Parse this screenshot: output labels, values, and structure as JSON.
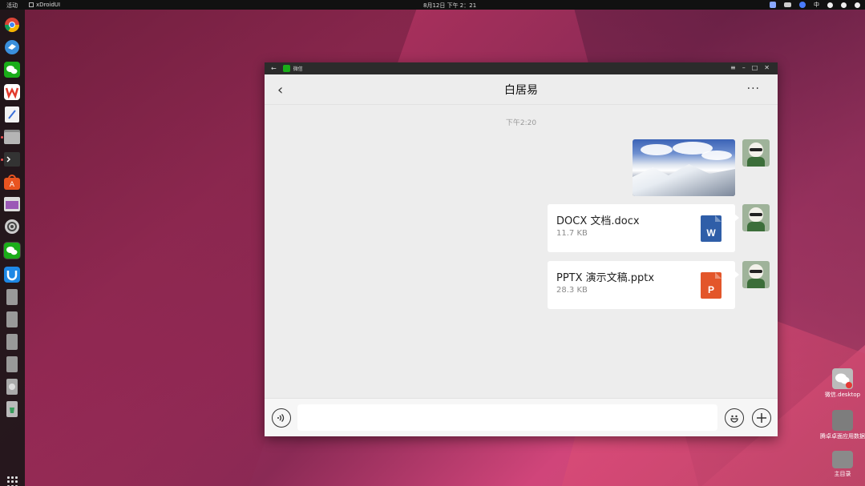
{
  "topbar": {
    "activities": "活动",
    "app_name": "xDroidUI",
    "clock": "8月12日 下午 2：21",
    "ime": "中"
  },
  "desktop": {
    "icons": [
      {
        "label": "微信.desktop"
      },
      {
        "label": "腾卓卓面应用数据"
      },
      {
        "label": "主目录"
      }
    ]
  },
  "window": {
    "app_title": "微信",
    "chat": {
      "title": "白居易",
      "timestamp": "下午2:20",
      "messages": [
        {
          "type": "image"
        },
        {
          "type": "file",
          "name": "DOCX 文档.docx",
          "size": "11.7 KB",
          "icon_letter": "W",
          "icon_color": "#2f5ea8"
        },
        {
          "type": "file",
          "name": "PPTX 演示文稿.pptx",
          "size": "28.3 KB",
          "icon_letter": "P",
          "icon_color": "#e3562a"
        }
      ]
    },
    "input": {
      "voice_icon": "voice-icon",
      "emoji_icon": "emoji-icon",
      "plus_icon": "plus-icon"
    }
  }
}
